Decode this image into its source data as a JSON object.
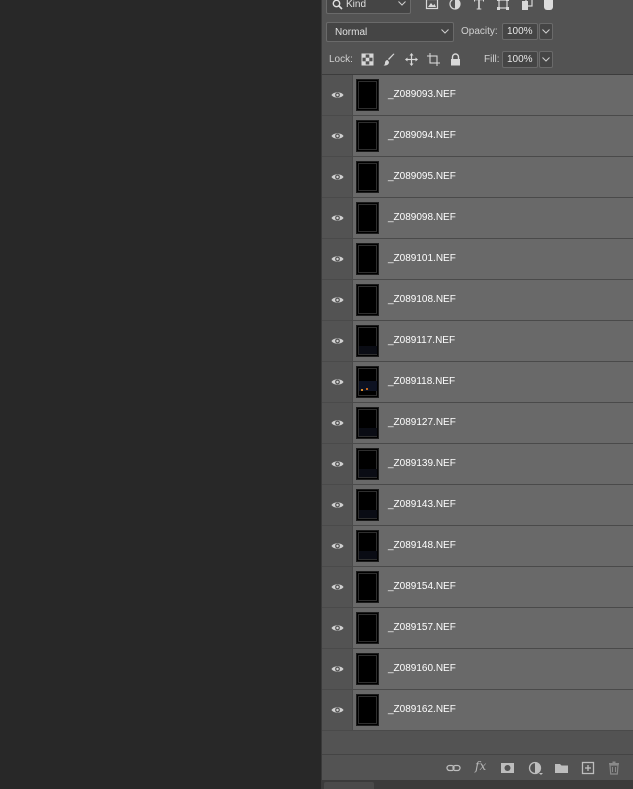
{
  "filter": {
    "kind_label": "Kind"
  },
  "blend": {
    "mode": "Normal",
    "opacity_label": "Opacity:",
    "opacity_value": "100%"
  },
  "lock": {
    "lock_label": "Lock:",
    "fill_label": "Fill:",
    "fill_value": "100%"
  },
  "layers": [
    {
      "name": "_Z089093.NEF",
      "visible": true,
      "thumb": "dark"
    },
    {
      "name": "_Z089094.NEF",
      "visible": true,
      "thumb": "dark"
    },
    {
      "name": "_Z089095.NEF",
      "visible": true,
      "thumb": "dark"
    },
    {
      "name": "_Z089098.NEF",
      "visible": true,
      "thumb": "dark"
    },
    {
      "name": "_Z089101.NEF",
      "visible": true,
      "thumb": "dark"
    },
    {
      "name": "_Z089108.NEF",
      "visible": true,
      "thumb": "dark"
    },
    {
      "name": "_Z089117.NEF",
      "visible": true,
      "thumb": "faint"
    },
    {
      "name": "_Z089118.NEF",
      "visible": true,
      "thumb": "lights"
    },
    {
      "name": "_Z089127.NEF",
      "visible": true,
      "thumb": "faint"
    },
    {
      "name": "_Z089139.NEF",
      "visible": true,
      "thumb": "faint"
    },
    {
      "name": "_Z089143.NEF",
      "visible": true,
      "thumb": "faint"
    },
    {
      "name": "_Z089148.NEF",
      "visible": true,
      "thumb": "faint"
    },
    {
      "name": "_Z089154.NEF",
      "visible": true,
      "thumb": "dark"
    },
    {
      "name": "_Z089157.NEF",
      "visible": true,
      "thumb": "dark"
    },
    {
      "name": "_Z089160.NEF",
      "visible": true,
      "thumb": "dark"
    },
    {
      "name": "_Z089162.NEF",
      "visible": true,
      "thumb": "dark"
    }
  ],
  "icons": {
    "filter": [
      "pixel-layer-filter-icon",
      "adjustment-layer-filter-icon",
      "type-layer-filter-icon",
      "shape-layer-filter-icon",
      "smart-object-filter-icon"
    ],
    "lock": [
      "lock-transparent-pixels-icon",
      "lock-image-pixels-icon",
      "lock-position-icon",
      "lock-artboard-icon",
      "lock-all-icon"
    ],
    "bottom": [
      "link-layers-icon",
      "fx-icon",
      "add-mask-icon",
      "new-adjustment-layer-icon",
      "new-group-icon",
      "new-layer-icon",
      "delete-layer-icon"
    ]
  },
  "colors": {
    "panel_bg": "#535353",
    "row_bg": "#696969",
    "canvas_bg": "#282828",
    "text": "#ffffff"
  }
}
